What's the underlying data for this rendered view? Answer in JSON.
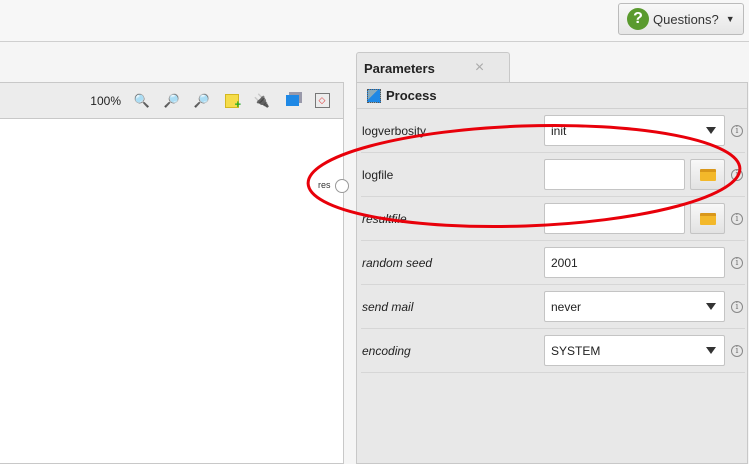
{
  "header": {
    "questions_label": "Questions?",
    "questions_icon": "?"
  },
  "toolbar": {
    "zoom_level": "100%"
  },
  "canvas": {
    "port_label": "res"
  },
  "panel": {
    "tab_label": "Parameters",
    "close_icon": "×",
    "section": "Process",
    "rows": [
      {
        "label": "logverbosity",
        "value": "init",
        "type": "select"
      },
      {
        "label": "logfile",
        "value": "",
        "type": "file"
      },
      {
        "label": "resultfile",
        "value": "",
        "type": "file"
      },
      {
        "label": "random seed",
        "value": "2001",
        "type": "text"
      },
      {
        "label": "send mail",
        "value": "never",
        "type": "select"
      },
      {
        "label": "encoding",
        "value": "SYSTEM",
        "type": "select"
      }
    ]
  },
  "annotation_color": "#e8000a"
}
